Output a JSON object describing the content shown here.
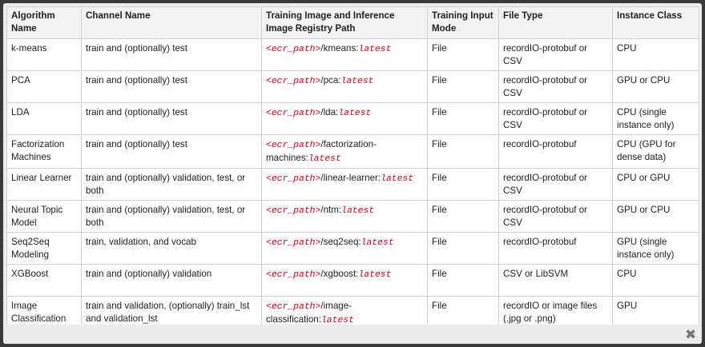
{
  "table": {
    "headers": [
      "Algorithm Name",
      "Channel Name",
      "Training Image and Inference Image Registry Path",
      "Training Input Mode",
      "File Type",
      "Instance Class"
    ],
    "rows": [
      {
        "algorithm": "k-means",
        "channel": "train and (optionally) test",
        "path_prefix": "<ecr_path>",
        "path_middle": "/kmeans:",
        "path_tag": "latest",
        "mode": "File",
        "file_type": "recordIO-protobuf or CSV",
        "instance": "CPU"
      },
      {
        "algorithm": "PCA",
        "channel": "train and (optionally) test",
        "path_prefix": "<ecr_path>",
        "path_middle": "/pca:",
        "path_tag": "latest",
        "mode": "File",
        "file_type": "recordIO-protobuf or CSV",
        "instance": "GPU or CPU"
      },
      {
        "algorithm": "LDA",
        "channel": "train and (optionally) test",
        "path_prefix": "<ecr_path>",
        "path_middle": "/lda:",
        "path_tag": "latest",
        "mode": "File",
        "file_type": "recordIO-protobuf or CSV",
        "instance": "CPU (single instance only)"
      },
      {
        "algorithm": "Factorization Machines",
        "channel": "train and (optionally) test",
        "path_prefix": "<ecr_path>",
        "path_middle": "/factorization-machines:",
        "path_tag": "latest",
        "mode": "File",
        "file_type": "recordIO-protobuf",
        "instance": "CPU (GPU for dense data)"
      },
      {
        "algorithm": "Linear Learner",
        "channel": "train and (optionally) validation, test, or both",
        "path_prefix": "<ecr_path>",
        "path_middle": "/linear-learner:",
        "path_tag": "latest",
        "mode": "File",
        "file_type": "recordIO-protobuf or CSV",
        "instance": "CPU or GPU"
      },
      {
        "algorithm": "Neural Topic Model",
        "channel": "train and (optionally) validation, test, or both",
        "path_prefix": "<ecr_path>",
        "path_middle": "/ntm:",
        "path_tag": "latest",
        "mode": "File",
        "file_type": "recordIO-protobuf or CSV",
        "instance": "GPU or CPU"
      },
      {
        "algorithm": "Seq2Seq Modeling",
        "channel": "train, validation, and vocab",
        "path_prefix": "<ecr_path>",
        "path_middle": "/seq2seq:",
        "path_tag": "latest",
        "mode": "File",
        "file_type": "recordIO-protobuf",
        "instance": "GPU (single instance only)"
      },
      {
        "algorithm": "XGBoost",
        "channel": "train and (optionally) validation",
        "path_prefix": "<ecr_path>",
        "path_middle": "/xgboost:",
        "path_tag": "latest",
        "mode": "File",
        "file_type": "CSV or LibSVM",
        "instance": "CPU"
      },
      {
        "algorithm": "Image Classification",
        "channel": "train and validation, (optionally) train_lst and validation_lst",
        "path_prefix": "<ecr_path>",
        "path_middle": "/image-classification:",
        "path_tag": "latest",
        "mode": "File",
        "file_type": "recordIO or image files (.jpg or .png)",
        "instance": "GPU"
      }
    ]
  },
  "footer": {
    "close_icon": "close-icon",
    "close_glyph": "✖"
  },
  "colors": {
    "ecr_path": "#d0021b",
    "overlay": "#3a3a3a",
    "modal": "#ececec"
  }
}
